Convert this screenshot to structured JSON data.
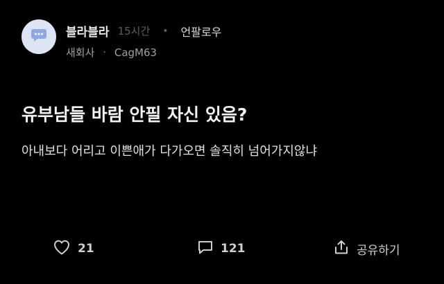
{
  "post": {
    "board": "블라블라",
    "time": "15시간",
    "follow_label": "언팔로우",
    "company": "새회사",
    "nickname": "CagM63",
    "title": "유부남들 바람 안필 자신 있음?",
    "content": "아내보다 어리고 이쁜애가 다가오면 솔직히 넘어가지않냐"
  },
  "actions": {
    "likes": "21",
    "comments": "121",
    "share_label": "공유하기"
  },
  "icons": {
    "avatar": "chat-bubble-icon",
    "like": "heart-icon",
    "comment": "comment-icon",
    "share": "share-icon"
  },
  "colors": {
    "background": "#000000",
    "avatar_bg": "#dde4f4",
    "avatar_icon": "#8ea8e6"
  }
}
